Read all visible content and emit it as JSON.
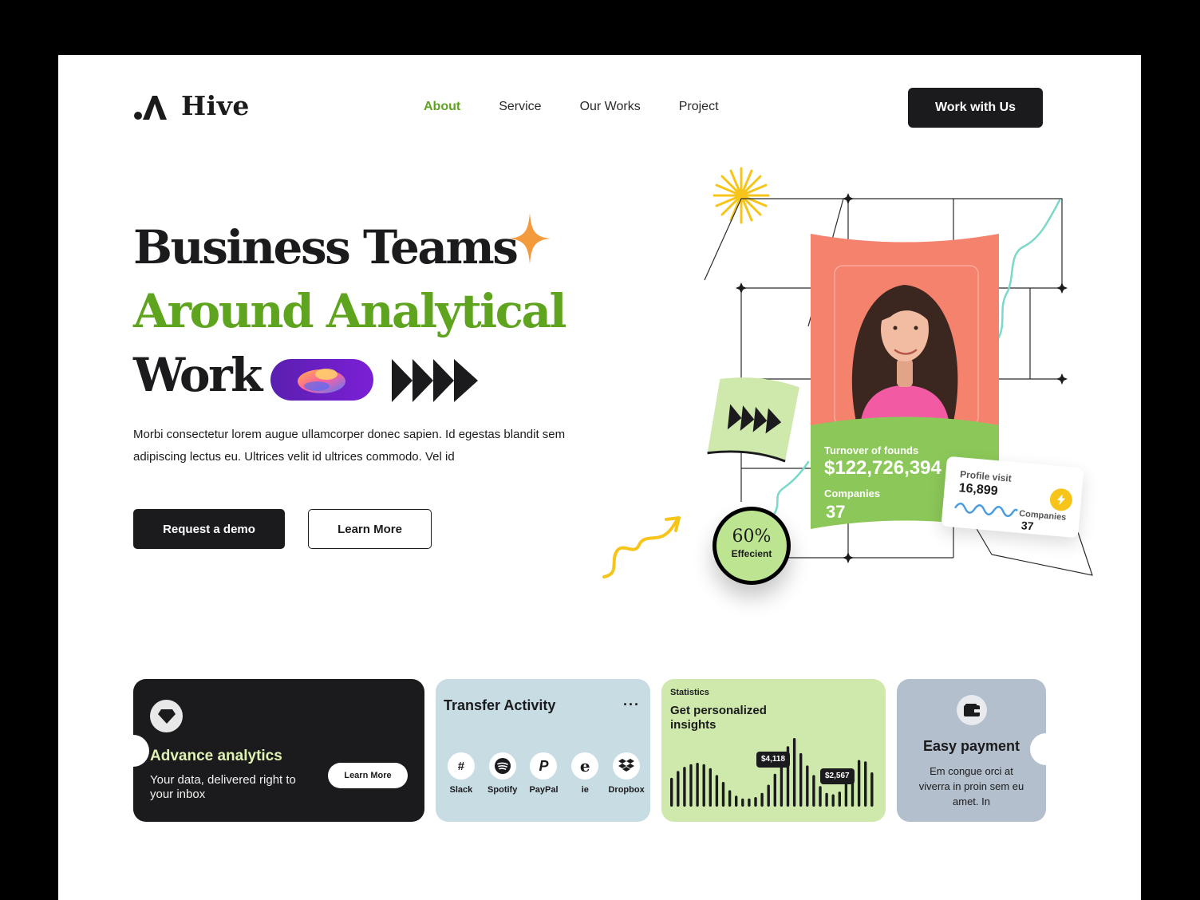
{
  "brand": {
    "name": "Hive"
  },
  "nav": {
    "items": [
      {
        "label": "About",
        "active": true
      },
      {
        "label": "Service",
        "active": false
      },
      {
        "label": "Our Works",
        "active": false
      },
      {
        "label": "Project",
        "active": false
      }
    ],
    "cta_label": "Work with Us"
  },
  "hero": {
    "line1": "Business Teams",
    "line2": "Around Analytical",
    "line3": "Work",
    "description": "Morbi consectetur lorem augue ullamcorper donec sapien. Id egestas blandit sem adipiscing lectus eu. Ultrices velit id ultrices commodo. Vel id",
    "primary_button": "Request a demo",
    "secondary_button": "Learn More"
  },
  "illustration": {
    "turnover_label": "Turnover of founds",
    "turnover_value": "$122,726,394",
    "companies_label": "Companies",
    "companies_value": "37",
    "profile_visit_label": "Profile visit",
    "profile_visit_value": "16,899",
    "profile_companies_label": "Companies",
    "profile_companies_value": "37",
    "efficiency_value": "60%",
    "efficiency_label": "Effecient"
  },
  "cards": {
    "analytics": {
      "title": "Advance analytics",
      "text": "Your data, delivered right to your inbox",
      "button": "Learn More"
    },
    "transfer": {
      "title": "Transfer Activity",
      "more_label": "···",
      "apps": [
        {
          "name": "Slack",
          "icon": "slack-icon"
        },
        {
          "name": "Spotify",
          "icon": "spotify-icon"
        },
        {
          "name": "PayPal",
          "icon": "paypal-icon"
        },
        {
          "name": "ie",
          "icon": "ie-icon"
        },
        {
          "name": "Dropbox",
          "icon": "dropbox-icon"
        }
      ]
    },
    "statistics": {
      "eyebrow": "Statistics",
      "title": "Get personalized insights",
      "tooltip_left": "$4,118",
      "tooltip_right": "$2,567",
      "bar_levels": [
        0.42,
        0.52,
        0.58,
        0.62,
        0.64,
        0.62,
        0.56,
        0.46,
        0.36,
        0.24,
        0.16,
        0.12,
        0.12,
        0.14,
        0.2,
        0.32,
        0.48,
        0.7,
        0.88,
        1.0,
        0.78,
        0.6,
        0.46,
        0.3,
        0.2,
        0.18,
        0.22,
        0.34,
        0.5,
        0.68,
        0.66,
        0.5
      ]
    },
    "payment": {
      "title": "Easy payment",
      "text": "Em congue orci at viverra in proin sem eu amet. In"
    }
  },
  "colors": {
    "accent_green": "#5fa41e",
    "dark": "#1b1b1d",
    "coral": "#f5826d",
    "lime": "#cfe9ac",
    "powder_blue": "#c8dce4",
    "slate": "#b3bfcc",
    "sun_yellow": "#f7c51a",
    "spark_orange": "#f39a3d"
  }
}
